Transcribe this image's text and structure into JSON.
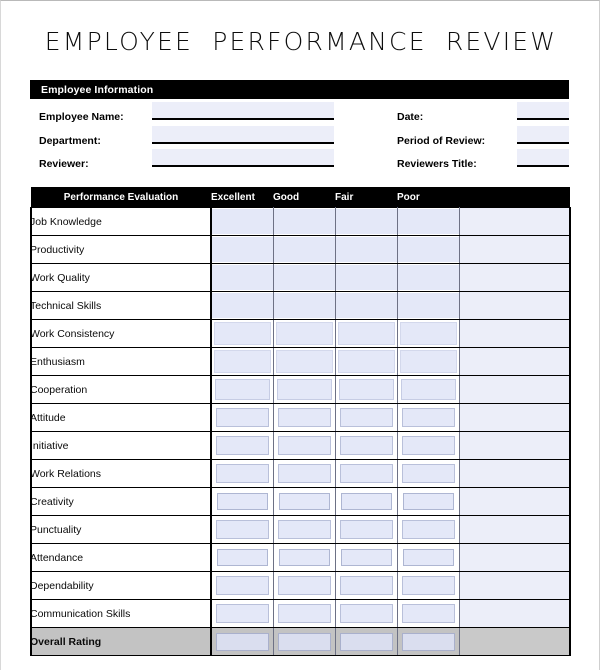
{
  "document": {
    "title": "EMPLOYEE PERFORMANCE REVIEW"
  },
  "employee_information": {
    "section_heading": "Employee Information",
    "fields_left": [
      {
        "label": "Employee Name:",
        "value": ""
      },
      {
        "label": "Department:",
        "value": ""
      },
      {
        "label": "Reviewer:",
        "value": ""
      }
    ],
    "fields_right": [
      {
        "label": "Date:",
        "value": ""
      },
      {
        "label": "Period of Review:",
        "value": ""
      },
      {
        "label": "Reviewers Title:",
        "value": ""
      }
    ]
  },
  "evaluation_table": {
    "headers": [
      "Performance Evaluation",
      "Excellent",
      "Good",
      "Fair",
      "Poor",
      ""
    ],
    "rows": [
      {
        "criterion": "Job Knowledge",
        "excellent": "",
        "good": "",
        "fair": "",
        "poor": "",
        "notes": ""
      },
      {
        "criterion": "Productivity",
        "excellent": "",
        "good": "",
        "fair": "",
        "poor": "",
        "notes": ""
      },
      {
        "criterion": "Work Quality",
        "excellent": "",
        "good": "",
        "fair": "",
        "poor": "",
        "notes": ""
      },
      {
        "criterion": "Technical Skills",
        "excellent": "",
        "good": "",
        "fair": "",
        "poor": "",
        "notes": ""
      },
      {
        "criterion": "Work Consistency",
        "excellent": "",
        "good": "",
        "fair": "",
        "poor": "",
        "notes": ""
      },
      {
        "criterion": "Enthusiasm",
        "excellent": "",
        "good": "",
        "fair": "",
        "poor": "",
        "notes": ""
      },
      {
        "criterion": "Cooperation",
        "excellent": "",
        "good": "",
        "fair": "",
        "poor": "",
        "notes": ""
      },
      {
        "criterion": "Attitude",
        "excellent": "",
        "good": "",
        "fair": "",
        "poor": "",
        "notes": ""
      },
      {
        "criterion": "Initiative",
        "excellent": "",
        "good": "",
        "fair": "",
        "poor": "",
        "notes": ""
      },
      {
        "criterion": "Work Relations",
        "excellent": "",
        "good": "",
        "fair": "",
        "poor": "",
        "notes": ""
      },
      {
        "criterion": "Creativity",
        "excellent": "",
        "good": "",
        "fair": "",
        "poor": "",
        "notes": ""
      },
      {
        "criterion": "Punctuality",
        "excellent": "",
        "good": "",
        "fair": "",
        "poor": "",
        "notes": ""
      },
      {
        "criterion": "Attendance",
        "excellent": "",
        "good": "",
        "fair": "",
        "poor": "",
        "notes": ""
      },
      {
        "criterion": "Dependability",
        "excellent": "",
        "good": "",
        "fair": "",
        "poor": "",
        "notes": ""
      },
      {
        "criterion": "Communication Skills",
        "excellent": "",
        "good": "",
        "fair": "",
        "poor": "",
        "notes": ""
      }
    ],
    "summary_row": {
      "criterion": "Overall Rating",
      "excellent": "",
      "good": "",
      "fair": "",
      "poor": "",
      "notes": ""
    }
  },
  "colors": {
    "header_band": "#000000",
    "header_text": "#ffffff",
    "field_fill": "#eceef9",
    "cell_fill": "#e4e8f8",
    "summary_fill": "#c3c3c3",
    "rule": "#000000",
    "cell_rule": "#4a4e63"
  }
}
